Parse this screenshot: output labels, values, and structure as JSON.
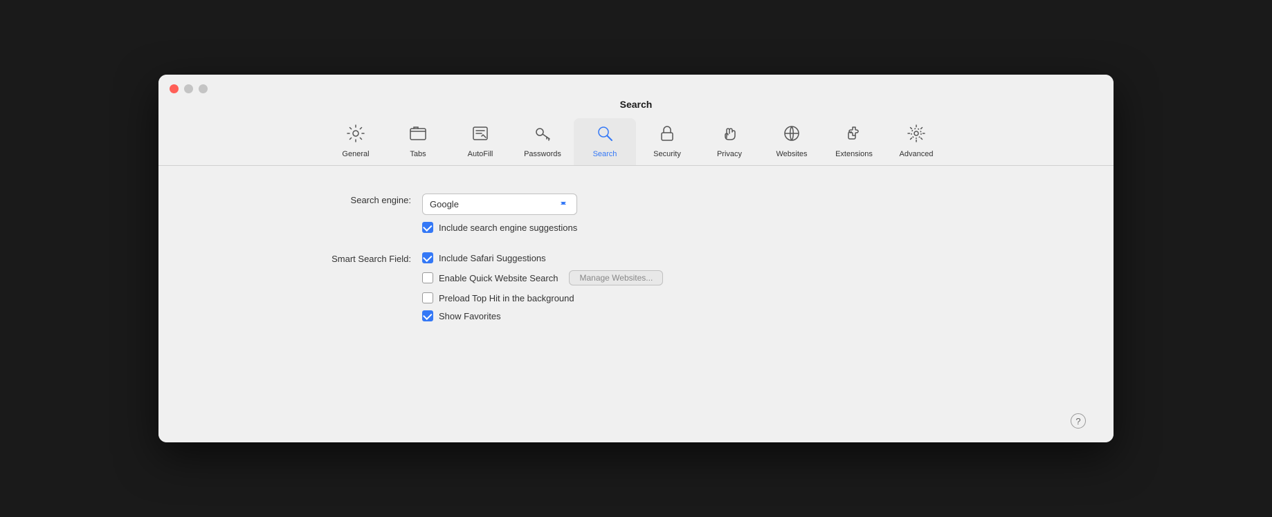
{
  "window": {
    "title": "Search"
  },
  "toolbar": {
    "items": [
      {
        "id": "general",
        "label": "General",
        "icon": "gear"
      },
      {
        "id": "tabs",
        "label": "Tabs",
        "icon": "tabs"
      },
      {
        "id": "autofill",
        "label": "AutoFill",
        "icon": "autofill"
      },
      {
        "id": "passwords",
        "label": "Passwords",
        "icon": "key"
      },
      {
        "id": "search",
        "label": "Search",
        "icon": "search",
        "active": true
      },
      {
        "id": "security",
        "label": "Security",
        "icon": "lock"
      },
      {
        "id": "privacy",
        "label": "Privacy",
        "icon": "hand"
      },
      {
        "id": "websites",
        "label": "Websites",
        "icon": "globe"
      },
      {
        "id": "extensions",
        "label": "Extensions",
        "icon": "puzzle"
      },
      {
        "id": "advanced",
        "label": "Advanced",
        "icon": "gear-advanced"
      }
    ]
  },
  "content": {
    "search_engine_label": "Search engine:",
    "search_engine_value": "Google",
    "checkboxes": {
      "include_suggestions": {
        "label": "Include search engine suggestions",
        "checked": true
      }
    },
    "smart_search_label": "Smart Search Field:",
    "smart_search_options": [
      {
        "label": "Include Safari Suggestions",
        "checked": true
      },
      {
        "label": "Enable Quick Website Search",
        "checked": false
      },
      {
        "label": "Preload Top Hit in the background",
        "checked": false
      },
      {
        "label": "Show Favorites",
        "checked": true
      }
    ],
    "manage_websites_btn": "Manage Websites..."
  },
  "help": {
    "label": "?"
  }
}
